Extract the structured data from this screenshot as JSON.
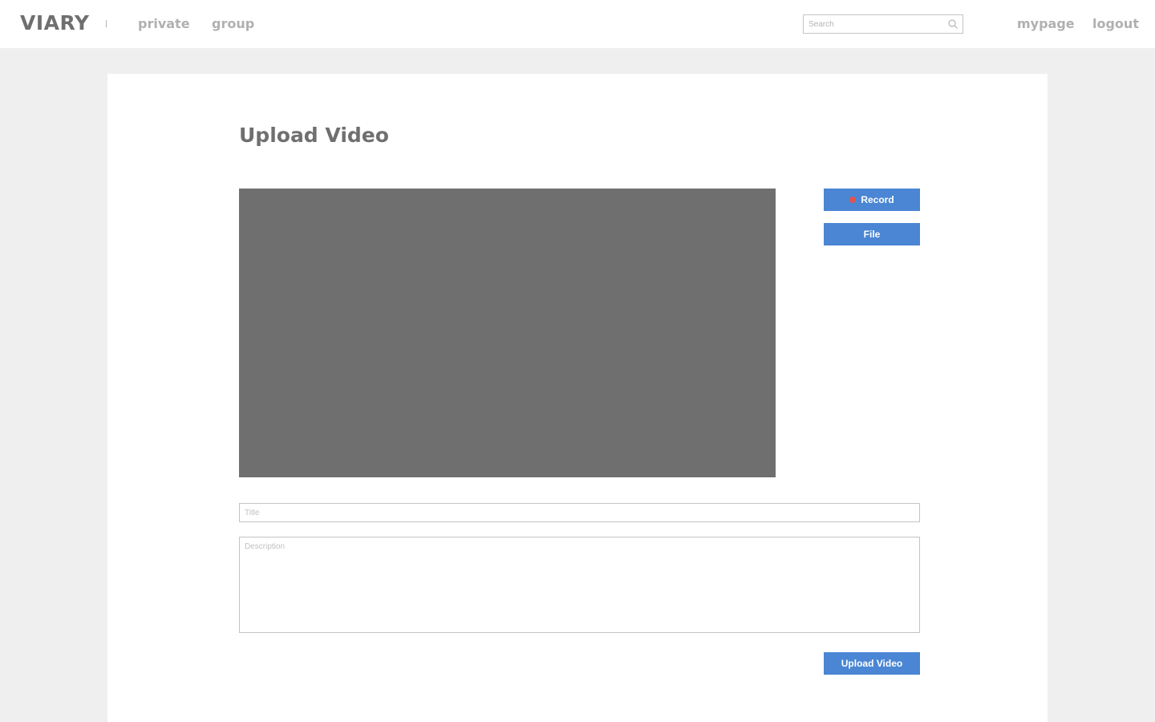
{
  "header": {
    "logo": "VIARY",
    "divider": "|",
    "nav": {
      "private": "private",
      "group": "group"
    },
    "search": {
      "placeholder": "Search",
      "value": "",
      "icon": "search-icon"
    },
    "user_nav": {
      "mypage": "mypage",
      "logout": "logout"
    }
  },
  "main": {
    "title": "Upload Video",
    "actions": {
      "record_label": "Record",
      "record_icon": "record-dot-icon",
      "file_label": "File"
    },
    "form": {
      "title_placeholder": "Title",
      "title_value": "",
      "description_placeholder": "Description",
      "description_value": "",
      "submit_label": "Upload Video"
    }
  },
  "colors": {
    "accent": "#4a86d4",
    "record_dot": "#e2524f",
    "preview": "#6f6f6f",
    "background": "#efefef"
  }
}
